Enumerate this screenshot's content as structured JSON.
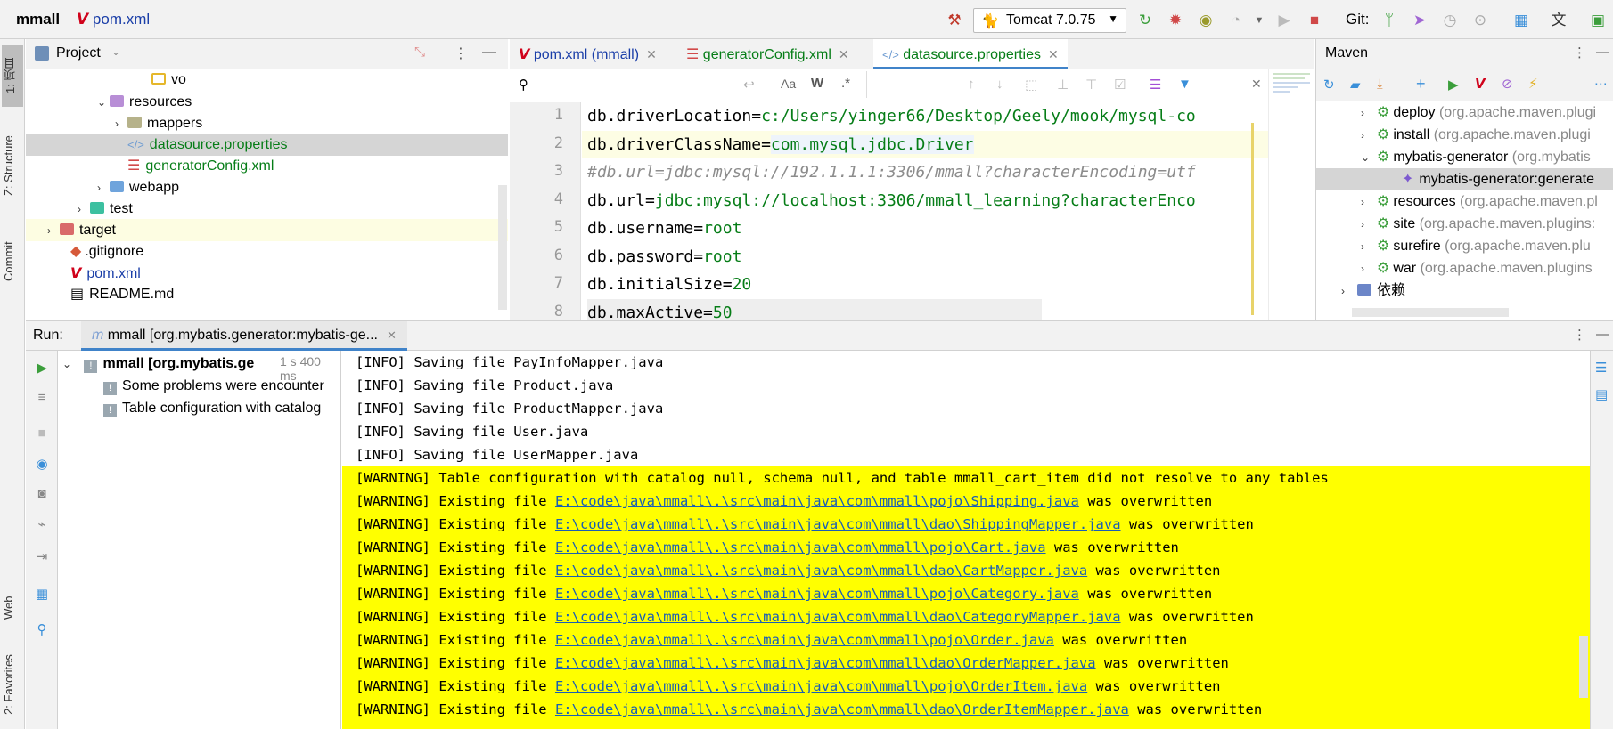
{
  "topbar": {
    "project": "mmall",
    "file": "pom.xml",
    "run_config": "Tomcat 7.0.75",
    "git_label": "Git:"
  },
  "left_strip": {
    "tabs": [
      "1: 项目",
      "Z: Structure",
      "Commit",
      "Web",
      "2: Favorites"
    ]
  },
  "project_panel": {
    "title": "Project",
    "tree": [
      {
        "label": "vo",
        "kind": "folder"
      },
      {
        "label": "resources",
        "kind": "res-folder"
      },
      {
        "label": "mappers",
        "kind": "folder"
      },
      {
        "label": "datasource.properties",
        "kind": "properties"
      },
      {
        "label": "generatorConfig.xml",
        "kind": "xml"
      },
      {
        "label": "webapp",
        "kind": "web-folder"
      },
      {
        "label": "test",
        "kind": "test-folder"
      },
      {
        "label": "target",
        "kind": "target-folder"
      },
      {
        "label": ".gitignore",
        "kind": "git"
      },
      {
        "label": "pom.xml",
        "kind": "maven"
      },
      {
        "label": "README.md",
        "kind": "md"
      }
    ]
  },
  "editor": {
    "tabs": [
      "pom.xml (mmall)",
      "generatorConfig.xml",
      "datasource.properties"
    ],
    "active_tab": "datasource.properties",
    "search_placeholder": "",
    "search_options": [
      "Aa",
      "W",
      ".*"
    ],
    "lines": [
      {
        "n": "1",
        "key": "db.driverLocation",
        "eq": "=",
        "val": "c:/Users/yinger66/Desktop/Geely/mook/mysql-co",
        "comment": ""
      },
      {
        "n": "2",
        "key": "db.driverClassName",
        "eq": "=",
        "val": "com.mysql.jdbc.Driver",
        "comment": ""
      },
      {
        "n": "3",
        "key": "",
        "eq": "",
        "val": "",
        "comment": "#db.url=jdbc:mysql://192.1.1.1:3306/mmall?characterEncoding=utf"
      },
      {
        "n": "4",
        "key": "db.url",
        "eq": "=",
        "val": "jdbc:mysql://localhost:3306/mmall_learning?characterEnco",
        "comment": ""
      },
      {
        "n": "5",
        "key": "db.username",
        "eq": "=",
        "val": "root",
        "comment": ""
      },
      {
        "n": "6",
        "key": "db.password",
        "eq": "=",
        "val": "root",
        "comment": ""
      },
      {
        "n": "7",
        "key": "db.initialSize",
        "eq": "=",
        "val": "20",
        "comment": ""
      },
      {
        "n": "8",
        "key": "db.maxActive",
        "eq": "=",
        "val": "50",
        "comment": ""
      }
    ]
  },
  "maven": {
    "title": "Maven",
    "tree": [
      {
        "label": "deploy",
        "group": "(org.apache.maven.plugi"
      },
      {
        "label": "install",
        "group": "(org.apache.maven.plugi"
      },
      {
        "label": "mybatis-generator",
        "group": "(org.mybatis"
      },
      {
        "label": "mybatis-generator:generate",
        "group": ""
      },
      {
        "label": "resources",
        "group": "(org.apache.maven.pl"
      },
      {
        "label": "site",
        "group": "(org.apache.maven.plugins:"
      },
      {
        "label": "surefire",
        "group": "(org.apache.maven.plu"
      },
      {
        "label": "war",
        "group": "(org.apache.maven.plugins"
      },
      {
        "label": "依赖",
        "group": ""
      }
    ]
  },
  "run": {
    "label": "Run:",
    "tab": "mmall [org.mybatis.generator:mybatis-ge...",
    "tree": {
      "root": "mmall [org.mybatis.ge",
      "root_time": "1 s 400 ms",
      "children": [
        "Some problems were encounter",
        "Table configuration with catalog"
      ]
    },
    "info_lines": [
      "[INFO] Saving file PayInfoMapper.java",
      "[INFO] Saving file Product.java",
      "[INFO] Saving file ProductMapper.java",
      "[INFO] Saving file User.java",
      "[INFO] Saving file UserMapper.java"
    ],
    "table_warning": "[WARNING] Table configuration with catalog null, schema null, and table mmall_cart_item did not resolve to any tables",
    "warn_prefix": "[WARNING] Existing file ",
    "warn_suffix": " was overwritten",
    "overwritten_files": [
      "E:\\code\\java\\mmall\\.\\src\\main\\java\\com\\mmall\\pojo\\Shipping.java",
      "E:\\code\\java\\mmall\\.\\src\\main\\java\\com\\mmall\\dao\\ShippingMapper.java",
      "E:\\code\\java\\mmall\\.\\src\\main\\java\\com\\mmall\\pojo\\Cart.java",
      "E:\\code\\java\\mmall\\.\\src\\main\\java\\com\\mmall\\dao\\CartMapper.java",
      "E:\\code\\java\\mmall\\.\\src\\main\\java\\com\\mmall\\pojo\\Category.java",
      "E:\\code\\java\\mmall\\.\\src\\main\\java\\com\\mmall\\dao\\CategoryMapper.java",
      "E:\\code\\java\\mmall\\.\\src\\main\\java\\com\\mmall\\pojo\\Order.java",
      "E:\\code\\java\\mmall\\.\\src\\main\\java\\com\\mmall\\dao\\OrderMapper.java",
      "E:\\code\\java\\mmall\\.\\src\\main\\java\\com\\mmall\\pojo\\OrderItem.java",
      "E:\\code\\java\\mmall\\.\\src\\main\\java\\com\\mmall\\dao\\OrderItemMapper.java"
    ]
  },
  "colors": {
    "warning_bg": "#ffff00",
    "link": "#1a5fb4",
    "value_green": "#067d17",
    "maven_red": "#d0021b",
    "accent": "#4083c9"
  }
}
